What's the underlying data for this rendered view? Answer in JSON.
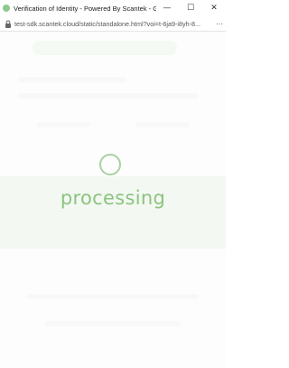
{
  "window": {
    "title": "Verification of Identity - Powered By Scantek - Google Chr...",
    "controls": {
      "minimize": "—",
      "maximize": "☐",
      "close": "✕"
    }
  },
  "address_bar": {
    "url": "test-sdk.scantek.cloud/static/standalone.html?voi=t-6ja9-i8yh-8...",
    "menu_glyph": "⋯"
  },
  "status": {
    "message": "processing"
  },
  "colors": {
    "accent": "#8cc47f",
    "spinner": "#a8d2a0",
    "band": "#e5efe3"
  }
}
